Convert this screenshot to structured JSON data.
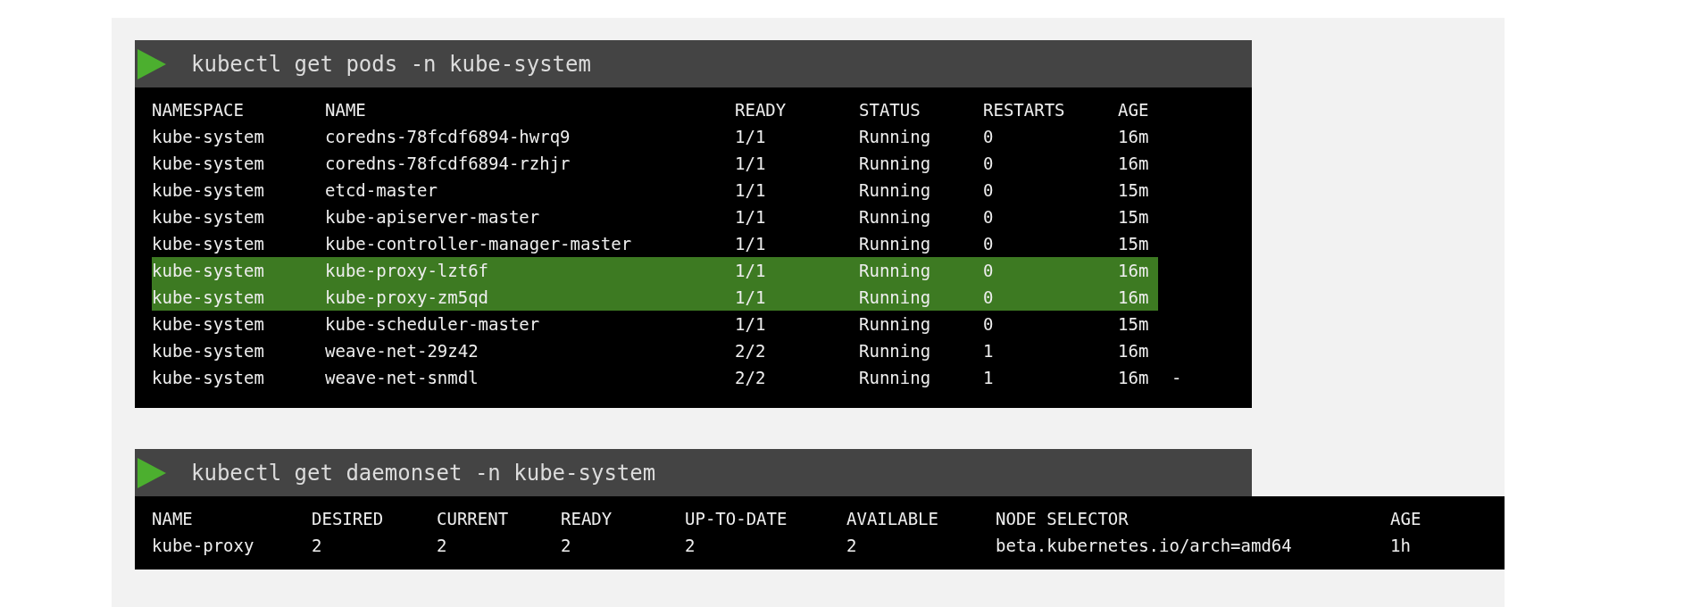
{
  "terminals": [
    {
      "command": "kubectl get pods -n kube-system",
      "columns": [
        "NAMESPACE",
        "NAME",
        "READY",
        "STATUS",
        "RESTARTS",
        "AGE"
      ],
      "rows": [
        {
          "cells": [
            "kube-system",
            "coredns-78fcdf6894-hwrq9",
            "1/1",
            "Running",
            "0",
            "16m"
          ],
          "highlighted": false
        },
        {
          "cells": [
            "kube-system",
            "coredns-78fcdf6894-rzhjr",
            "1/1",
            "Running",
            "0",
            "16m"
          ],
          "highlighted": false
        },
        {
          "cells": [
            "kube-system",
            "etcd-master",
            "1/1",
            "Running",
            "0",
            "15m"
          ],
          "highlighted": false
        },
        {
          "cells": [
            "kube-system",
            "kube-apiserver-master",
            "1/1",
            "Running",
            "0",
            "15m"
          ],
          "highlighted": false
        },
        {
          "cells": [
            "kube-system",
            "kube-controller-manager-master",
            "1/1",
            "Running",
            "0",
            "15m"
          ],
          "highlighted": false
        },
        {
          "cells": [
            "kube-system",
            "kube-proxy-lzt6f",
            "1/1",
            "Running",
            "0",
            "16m"
          ],
          "highlighted": true
        },
        {
          "cells": [
            "kube-system",
            "kube-proxy-zm5qd",
            "1/1",
            "Running",
            "0",
            "16m"
          ],
          "highlighted": true
        },
        {
          "cells": [
            "kube-system",
            "kube-scheduler-master",
            "1/1",
            "Running",
            "0",
            "15m"
          ],
          "highlighted": false
        },
        {
          "cells": [
            "kube-system",
            "weave-net-29z42",
            "2/2",
            "Running",
            "1",
            "16m"
          ],
          "highlighted": false
        },
        {
          "cells": [
            "kube-system",
            "weave-net-snmdl",
            "2/2",
            "Running",
            "1",
            "16m"
          ],
          "highlighted": false,
          "trailing": "-"
        }
      ]
    },
    {
      "command": "kubectl get daemonset -n kube-system",
      "columns": [
        "NAME",
        "DESIRED",
        "CURRENT",
        "READY",
        "UP-TO-DATE",
        "AVAILABLE",
        "NODE SELECTOR",
        "AGE"
      ],
      "rows": [
        {
          "cells": [
            "kube-proxy",
            "2",
            "2",
            "2",
            "2",
            "2",
            "beta.kubernetes.io/arch=amd64",
            "1h"
          ],
          "highlighted": false
        }
      ]
    }
  ]
}
